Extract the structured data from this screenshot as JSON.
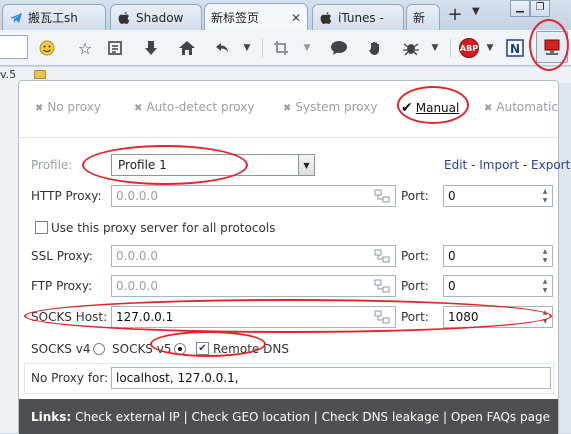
{
  "tabs": [
    {
      "title": "搬瓦工sh",
      "favicon": "telegram-icon"
    },
    {
      "title": "Shadow",
      "favicon": "apple-icon"
    },
    {
      "title": "新标签页",
      "favicon": "none",
      "active": true
    },
    {
      "title": "iTunes - ",
      "favicon": "apple-icon"
    },
    {
      "title": "新",
      "favicon": "apple-icon"
    }
  ],
  "toolbar": {
    "icons": [
      "smiley-icon",
      "star-icon",
      "reading-list-icon",
      "download-icon",
      "home-icon",
      "back-icon",
      "crop-icon",
      "chat-icon",
      "hand-icon",
      "bug-icon",
      "adblock-plus-icon",
      "n-icon",
      "proxy-icon"
    ],
    "adblock_label": "ABP"
  },
  "bookmarks": {
    "text": "v.5"
  },
  "proxy_panel": {
    "modes": [
      {
        "label": "No proxy",
        "active": false
      },
      {
        "label": "Auto-detect proxy",
        "active": false
      },
      {
        "label": "System proxy",
        "active": false
      },
      {
        "label": "Manual",
        "active": true
      },
      {
        "label": "Automatic",
        "active": false
      }
    ],
    "profile_label": "Profile:",
    "profile_value": "Profile 1",
    "profile_actions": [
      "Edit",
      "Import",
      "Export"
    ],
    "http_label": "HTTP Proxy:",
    "http_placeholder": "0.0.0.0",
    "port_label": "Port:",
    "http_port": "0",
    "use_all_label": "Use this proxy server for all protocols",
    "ssl_label": "SSL Proxy:",
    "ssl_placeholder": "0.0.0.0",
    "ssl_port": "0",
    "ftp_label": "FTP Proxy:",
    "ftp_placeholder": "0.0.0.0",
    "ftp_port": "0",
    "socks_label": "SOCKS Host:",
    "socks_host": "127.0.0.1",
    "socks_port": "1080",
    "socks_v4_label": "SOCKS v4",
    "socks_v5_label": "SOCKS v5",
    "socks_version": "v5",
    "remote_dns_label": "Remote DNS",
    "remote_dns_checked": true,
    "no_proxy_label": "No Proxy for:",
    "no_proxy_value": "localhost, 127.0.0.1,"
  },
  "footer": {
    "links_label": "Links:",
    "links": [
      "Check external IP",
      "Check GEO location",
      "Check DNS leakage",
      "Open FAQs page"
    ]
  },
  "colors": {
    "annotation": "#e0262b",
    "link": "#2a3fa8",
    "footer_bg": "#4d4f52"
  }
}
